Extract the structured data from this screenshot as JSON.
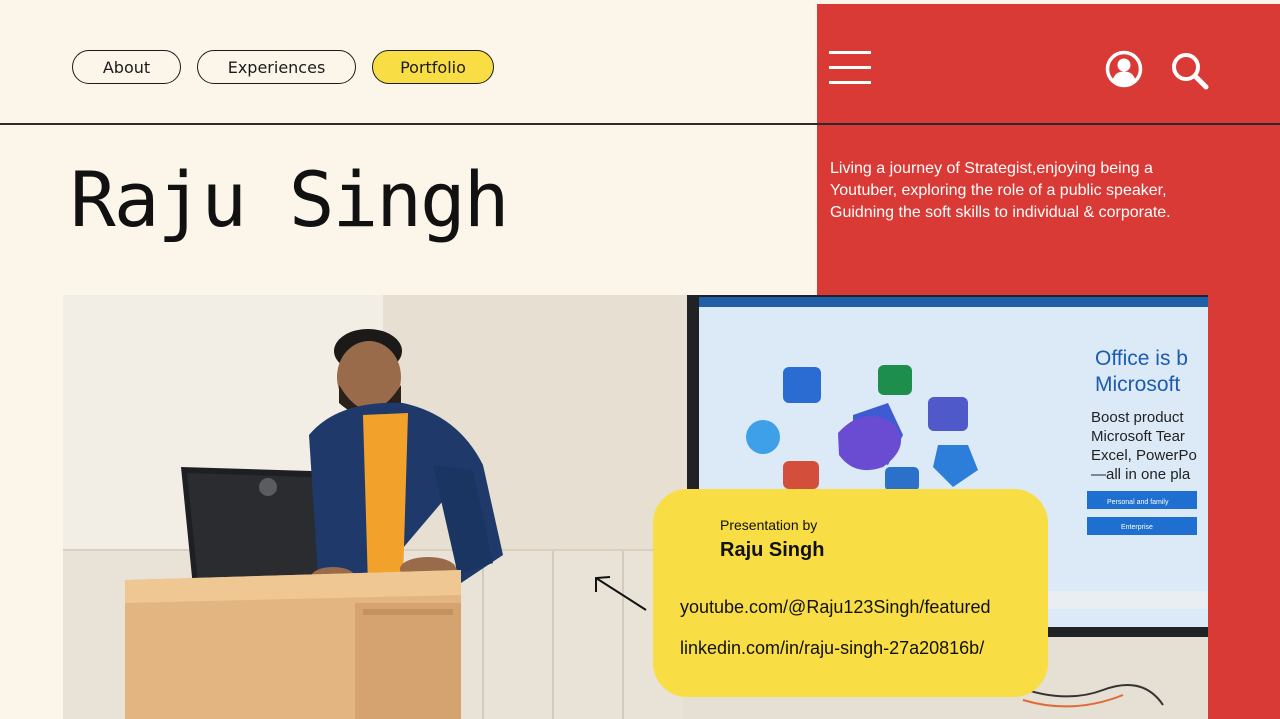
{
  "nav": {
    "items": [
      {
        "label": "About"
      },
      {
        "label": "Experiences"
      },
      {
        "label": "Portfolio",
        "active": true
      }
    ]
  },
  "header": {
    "menu_icon": "hamburger-menu-icon",
    "account_icon": "user-circle-icon",
    "search_icon": "magnifier-icon"
  },
  "hero": {
    "title": "Raju Singh",
    "tagline": "Living a journey of Strategist,enjoying being a Youtuber, exploring the role of a public speaker, Guidning the soft skills to individual & corporate."
  },
  "card": {
    "label": "Presentation by",
    "name": "Raju Singh",
    "links": [
      "youtube.com/@Raju123Singh/featured",
      "linkedin.com/in/raju-singh-27a20816b/"
    ]
  },
  "screen": {
    "heading_line1": "Office is b",
    "heading_line2": "Microsoft",
    "body_lines": [
      "Boost product",
      "Microsoft Tear",
      "Excel, PowerPo",
      "—all in one pla"
    ],
    "button1": "Personal and family",
    "button2": "Enterprise"
  },
  "colors": {
    "background": "#FCF5EA",
    "panel_red": "#DA3A35",
    "accent_yellow": "#F8DE44",
    "text_dark": "#111111"
  }
}
